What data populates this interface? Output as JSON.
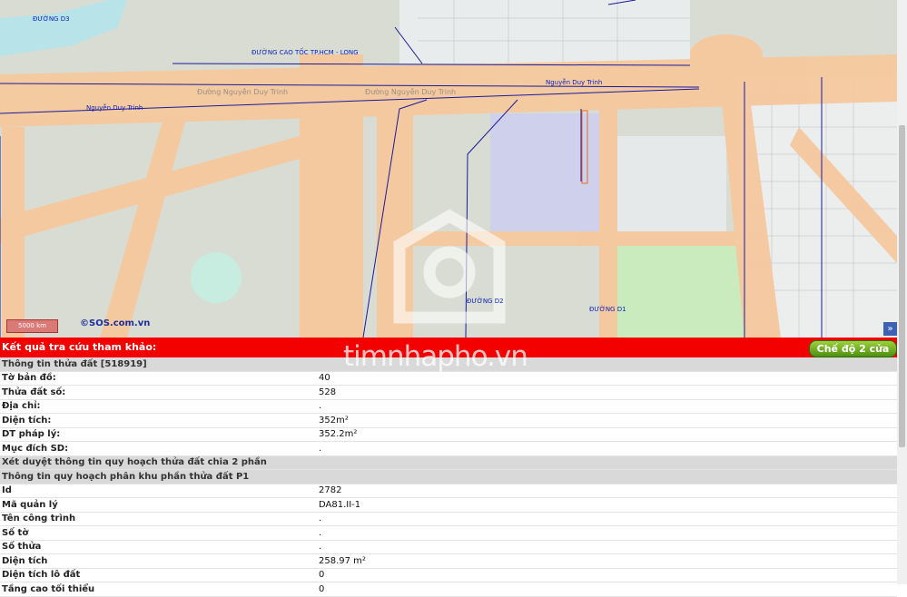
{
  "map": {
    "labels": {
      "duong_d3": "ĐƯỜNG D3",
      "cao_toc": "ĐƯỜNG CAO TỐC TP.HCM - LONG",
      "nguyen_duy_trinh_left": "Nguyễn Duy Trinh",
      "nguyen_duy_trinh_right": "Nguyễn Duy Trinh",
      "duong_d2": "ĐƯỜNG D2",
      "duong_d1": "ĐƯỜNG D1",
      "road_nguyen_duy_trinh_1": "Đường Nguyễn Duy Trinh",
      "road_nguyen_duy_trinh_2": "Đường Nguyễn Duy Trinh"
    },
    "scale_label": "5000 km",
    "copyright": "©SOS.com.vn",
    "expand_glyph": "»",
    "colors": {
      "road": "#f6c89e",
      "background": "#d9dcd3",
      "blue_line": "#1a1a9c",
      "park": "#b8e6a8"
    }
  },
  "result": {
    "title": "Kết quả tra cứu tham khảo:",
    "mode_button": "Chế độ 2 cửa sổ",
    "watermark": "timnhapho.vn"
  },
  "rows": [
    {
      "type": "head",
      "label": "Thông tin thửa đất [518919]"
    },
    {
      "label": "Tờ bản đồ:",
      "value": "40"
    },
    {
      "label": "Thửa đất số:",
      "value": "528"
    },
    {
      "label": "Địa chỉ:",
      "value": "."
    },
    {
      "label": "Diện tích:",
      "value": "352m²"
    },
    {
      "label": "DT pháp lý:",
      "value": "352.2m²"
    },
    {
      "label": "Mục đích SD:",
      "value": "."
    },
    {
      "type": "head",
      "label": "Xét duyệt thông tin quy hoạch thửa đất chia 2 phần"
    },
    {
      "type": "head",
      "label": "Thông tin quy hoạch phân khu phần thửa đất P1"
    },
    {
      "label": "Id",
      "value": "2782"
    },
    {
      "label": "Mã quản lý",
      "value": "DA81.II-1"
    },
    {
      "label": "Tên công trình",
      "value": "."
    },
    {
      "label": "Số tờ",
      "value": "."
    },
    {
      "label": "Số thửa",
      "value": "."
    },
    {
      "label": "Diện tích",
      "value": "258.97 m²"
    },
    {
      "label": "Diện tích lô đất",
      "value": "0"
    },
    {
      "label": "Tầng cao tối thiểu",
      "value": "0"
    }
  ]
}
